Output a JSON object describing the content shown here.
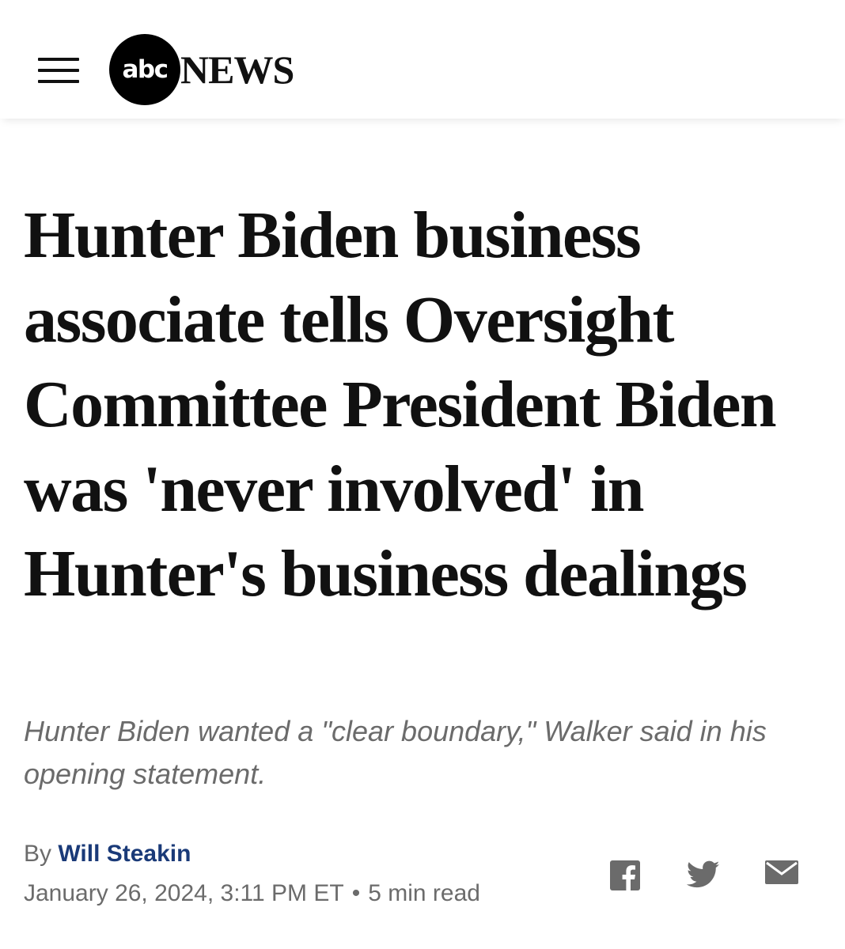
{
  "header": {
    "logo_abc": "abc",
    "logo_news": "NEWS",
    "menu_icon": "hamburger-menu-icon"
  },
  "article": {
    "headline": "Hunter Biden business associate tells Oversight Committee President Biden was 'never involved' in Hunter's business dealings",
    "subhead": "Hunter Biden wanted a \"clear boundary,\" Walker said in his opening statement.",
    "byline_prefix": "By",
    "author": "Will Steakin",
    "date": "January 26, 2024, 3:11 PM ET",
    "separator": "•",
    "read_time": "5 min read"
  },
  "share": {
    "icons": [
      "facebook-icon",
      "twitter-icon",
      "email-icon"
    ]
  },
  "colors": {
    "author_link": "#1a3a78",
    "muted_text": "#6b6b6b",
    "headline": "#111111"
  }
}
